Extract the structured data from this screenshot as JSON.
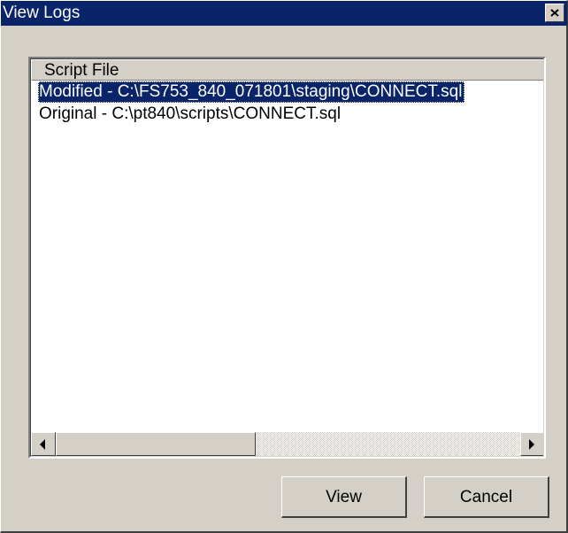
{
  "window": {
    "title": "View Logs"
  },
  "listview": {
    "column_header": "Script File",
    "rows": [
      {
        "text": "Modified - C:\\FS753_840_071801\\staging\\CONNECT.sql",
        "selected": true
      },
      {
        "text": "Original - C:\\pt840\\scripts\\CONNECT.sql",
        "selected": false
      }
    ]
  },
  "buttons": {
    "view": "View",
    "cancel": "Cancel"
  },
  "colors": {
    "titlebar": "#0a246a",
    "face": "#d4d0c8",
    "selection": "#0a246a"
  }
}
